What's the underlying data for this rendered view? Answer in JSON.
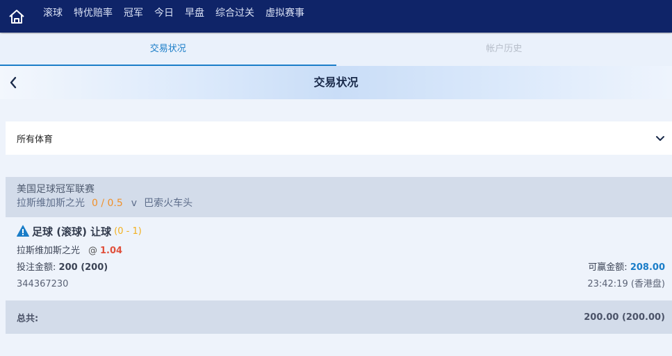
{
  "nav": {
    "items": [
      "滚球",
      "特优赔率",
      "冠军",
      "今日",
      "早盘",
      "综合过关",
      "虚拟赛事"
    ]
  },
  "tabs": [
    {
      "label": "交易状况",
      "active": true
    },
    {
      "label": "帐户历史",
      "active": false
    }
  ],
  "header": {
    "title": "交易状况"
  },
  "filter": {
    "selected": "所有体育"
  },
  "league": {
    "name": "美国足球冠军联赛",
    "home_team": "拉斯维加斯之光",
    "handicap": "0 / 0.5",
    "vs": "v",
    "away_team": "巴索火车头"
  },
  "bet": {
    "title": "足球 (滚球) 让球",
    "score": "(0 - 1)",
    "selection": "拉斯维加斯之光",
    "at": "@",
    "odds": "1.04",
    "stake_label": "投注金额:",
    "stake_value": "200 (200)",
    "win_label": "可赢金额:",
    "win_value": "208.00",
    "ticket_id": "344367230",
    "time": "23:42:19 (香港盘)"
  },
  "total": {
    "label": "总共:",
    "value": "200.00 (200.00)"
  },
  "colors": {
    "nav_bg": "#0f2468",
    "accent": "#1a7dc8",
    "handicap": "#f0902a",
    "odds": "#e0503c",
    "score": "#f2b01e"
  }
}
